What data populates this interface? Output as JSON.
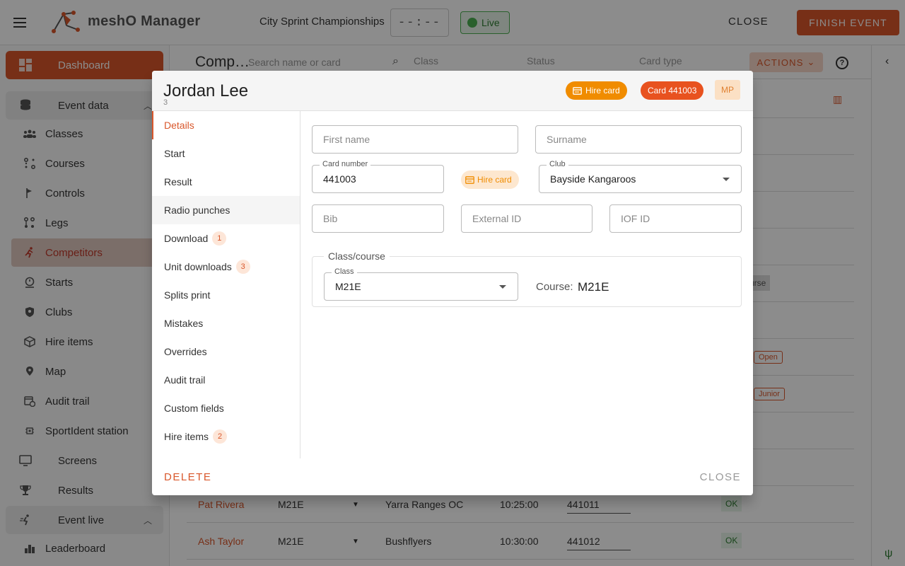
{
  "header": {
    "app_name": "meshO Manager",
    "event_name": "City Sprint Championships",
    "clock": "--:--",
    "live_label": "Live",
    "close_label": "CLOSE",
    "finish_label": "FINISH EVENT"
  },
  "sidebar": {
    "dashboard": "Dashboard",
    "event_data": "Event data",
    "items": [
      "Classes",
      "Courses",
      "Controls",
      "Legs",
      "Competitors",
      "Starts",
      "Clubs",
      "Hire items",
      "Map",
      "Audit trail",
      "SportIdent station"
    ],
    "screens": "Screens",
    "results": "Results",
    "event_live": "Event live",
    "leaderboard": "Leaderboard"
  },
  "toolbar": {
    "title": "Comp…",
    "search_placeholder": "Search name or card",
    "class_placeholder": "Class",
    "status_placeholder": "Status",
    "cardtype_placeholder": "Card type",
    "actions_label": "ACTIONS"
  },
  "table": {
    "rows": [
      {
        "name": "Pat Rivera",
        "class": "M21E",
        "club": "Yarra Ranges OC",
        "start": "10:25:00",
        "card": "441011",
        "status": "OK"
      },
      {
        "name": "Ash Taylor",
        "class": "M21E",
        "club": "Bushflyers",
        "start": "10:30:00",
        "card": "441012",
        "status": "OK"
      }
    ],
    "tag_open": "Open",
    "tag_junior": "Junior",
    "partial_course": "urse"
  },
  "dialog": {
    "name": "Jordan Lee",
    "subtitle": "3",
    "chip_hire": "Hire card",
    "chip_card": "Card 441003",
    "chip_mp": "MP",
    "nav": [
      {
        "label": "Details"
      },
      {
        "label": "Start"
      },
      {
        "label": "Result"
      },
      {
        "label": "Radio punches"
      },
      {
        "label": "Download",
        "badge": "1"
      },
      {
        "label": "Unit downloads",
        "badge": "3"
      },
      {
        "label": "Splits print"
      },
      {
        "label": "Mistakes"
      },
      {
        "label": "Overrides"
      },
      {
        "label": "Audit trail"
      },
      {
        "label": "Custom fields"
      },
      {
        "label": "Hire items",
        "badge": "2"
      }
    ],
    "fields": {
      "first_name_ph": "First name",
      "surname_ph": "Surname",
      "card_label": "Card number",
      "card_value": "441003",
      "hire_label": "Hire card",
      "club_label": "Club",
      "club_value": "Bayside Kangaroos",
      "bib_ph": "Bib",
      "external_ph": "External ID",
      "iof_ph": "IOF ID",
      "classcourse_legend": "Class/course",
      "class_label": "Class",
      "class_value": "M21E",
      "course_label": "Course:",
      "course_value": "M21E"
    },
    "delete_label": "DELETE",
    "close_label": "CLOSE"
  }
}
